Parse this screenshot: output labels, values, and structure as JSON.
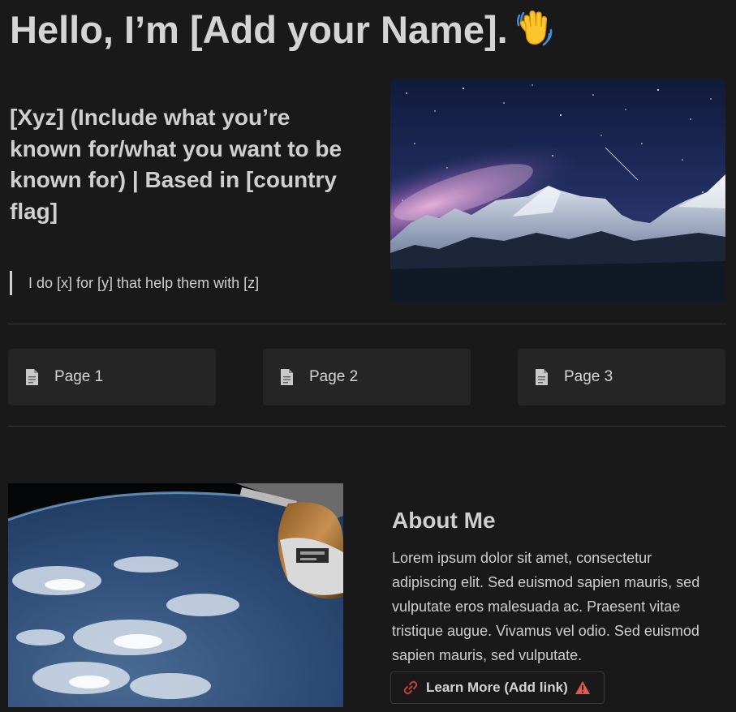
{
  "header": {
    "title": "Hello, I’m [Add your Name].",
    "wave_icon": "waving-hand-emoji"
  },
  "intro": {
    "tagline": "[Xyz] (Include what you’re known for/what you want to be known for) | Based in [country flag]",
    "quote": "I do [x] for [y] that help them with [z]"
  },
  "images": {
    "hero": "mountain-milky-way-photo",
    "about": "earth-from-space-station-photo"
  },
  "pages": [
    {
      "label": "Page 1",
      "icon": "document-icon"
    },
    {
      "label": "Page 2",
      "icon": "document-icon"
    },
    {
      "label": "Page 3",
      "icon": "document-icon"
    }
  ],
  "about": {
    "title": "About Me",
    "text": "Lorem ipsum dolor sit amet, consectetur adipiscing elit. Sed euismod sapien mauris, sed vulputate eros malesuada ac. Praesent vitae tristique augue. Vivamus vel odio. Sed euismod sapien mauris, sed vulputate.",
    "button_label": "Learn More (Add link)",
    "button_icon": "link-icon",
    "warning_icon": "warning-icon"
  },
  "colors": {
    "background": "#191919",
    "card": "#252525",
    "text": "#d4d4d4",
    "link_red": "#c2403a",
    "warning_red": "#e05a52"
  }
}
